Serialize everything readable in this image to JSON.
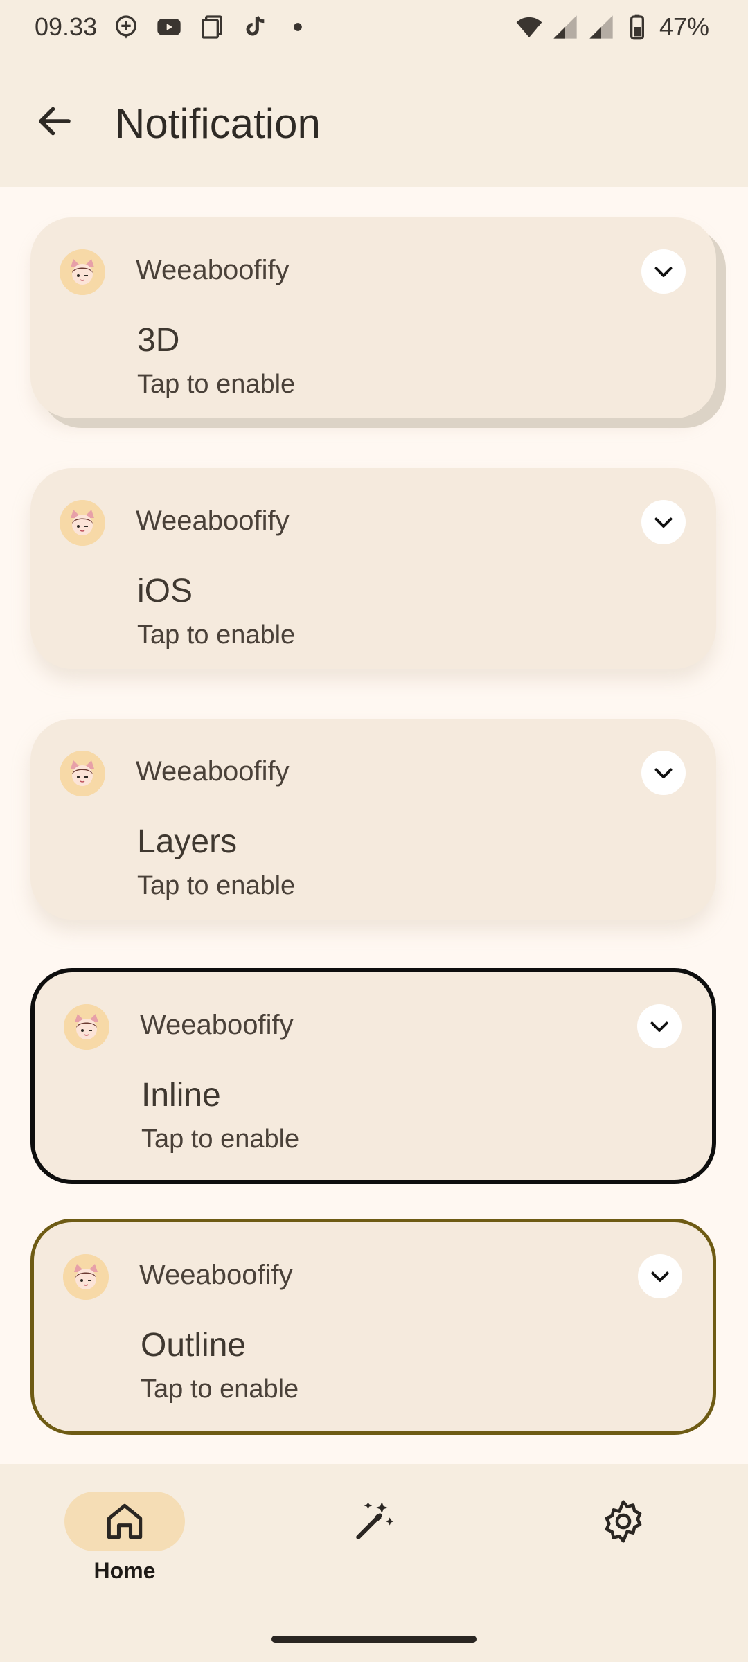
{
  "status_bar": {
    "time": "09.33",
    "battery": "47%",
    "icons": [
      "add-location-icon",
      "youtube-icon",
      "copy-icon",
      "tiktok-icon",
      "dot-icon",
      "wifi-icon",
      "signal-icon",
      "signal-icon",
      "battery-icon"
    ]
  },
  "app_bar": {
    "back_icon": "arrow-back-icon",
    "title": "Notification"
  },
  "cards": [
    {
      "app_name": "Weeaboofify",
      "title": "3D",
      "subtitle": "Tap to enable",
      "style": "layered"
    },
    {
      "app_name": "Weeaboofify",
      "title": "iOS",
      "subtitle": "Tap to enable",
      "style": "soft"
    },
    {
      "app_name": "Weeaboofify",
      "title": "Layers",
      "subtitle": "Tap to enable",
      "style": "soft"
    },
    {
      "app_name": "Weeaboofify",
      "title": "Inline",
      "subtitle": "Tap to enable",
      "style": "inline"
    },
    {
      "app_name": "Weeaboofify",
      "title": "Outline",
      "subtitle": "Tap to enable",
      "style": "outline"
    }
  ],
  "bottom_nav": {
    "items": [
      {
        "label": "Home",
        "icon": "home-icon",
        "active": true
      },
      {
        "label": "",
        "icon": "magic-wand-icon",
        "active": false
      },
      {
        "label": "",
        "icon": "settings-icon",
        "active": false
      }
    ]
  },
  "colors": {
    "background": "#FFF8F2",
    "surface": "#F6EDE0",
    "card": "#F5EADD",
    "nav_active": "#F5DDB5",
    "outline_border": "#6E5B14",
    "inline_border": "#0E0E0E"
  }
}
